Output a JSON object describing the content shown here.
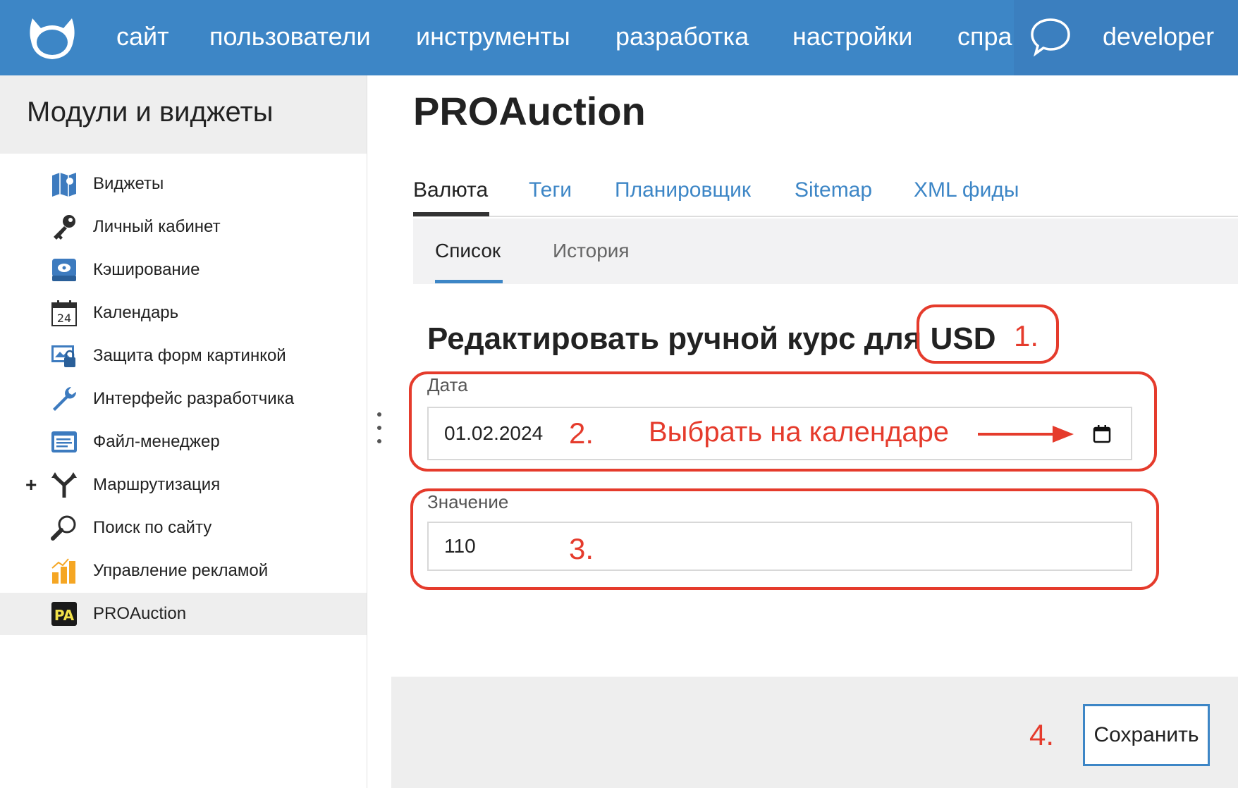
{
  "topnav": {
    "items": [
      "сайт",
      "пользователи",
      "инструменты",
      "разработка",
      "настройки",
      "справ"
    ],
    "user": "developer"
  },
  "sidebar": {
    "title": "Модули и виджеты",
    "items": [
      {
        "label": "Виджеты",
        "icon": "map-icon"
      },
      {
        "label": "Личный кабинет",
        "icon": "key-icon"
      },
      {
        "label": "Кэширование",
        "icon": "disk-icon"
      },
      {
        "label": "Календарь",
        "icon": "calendar-icon",
        "icon_text": "24"
      },
      {
        "label": "Защита форм картинкой",
        "icon": "captcha-lock-icon"
      },
      {
        "label": "Интерфейс разработчика",
        "icon": "wrench-icon"
      },
      {
        "label": "Файл-менеджер",
        "icon": "file-manager-icon"
      },
      {
        "label": "Маршрутизация",
        "icon": "routing-icon",
        "expander": "+"
      },
      {
        "label": "Поиск по сайту",
        "icon": "magnifier-icon"
      },
      {
        "label": "Управление рекламой",
        "icon": "bar-chart-icon"
      },
      {
        "label": "PROAuction",
        "icon": "pa-logo-icon",
        "icon_text": "PA",
        "active": true
      }
    ]
  },
  "main": {
    "title": "PROAuction",
    "tabs": [
      "Валюта",
      "Теги",
      "Планировщик",
      "Sitemap",
      "XML фиды"
    ],
    "active_tab": "Валюта",
    "subtabs": [
      "Список",
      "История"
    ],
    "active_subtab": "Список",
    "form": {
      "title_prefix": "Редактировать ручной курс для",
      "currency": "USD",
      "date_label": "Дата",
      "date_value": "01.02.2024",
      "value_label": "Значение",
      "value_value": "110",
      "save_label": "Сохранить"
    }
  },
  "annotations": {
    "step1": "1.",
    "step2": "2.",
    "step2_hint": "Выбрать на календаре",
    "step3": "3.",
    "step4": "4.",
    "color": "#e53b2c"
  },
  "colors": {
    "topbar": "#3d86c6",
    "link": "#3d86c6",
    "annotation": "#e53b2c"
  }
}
